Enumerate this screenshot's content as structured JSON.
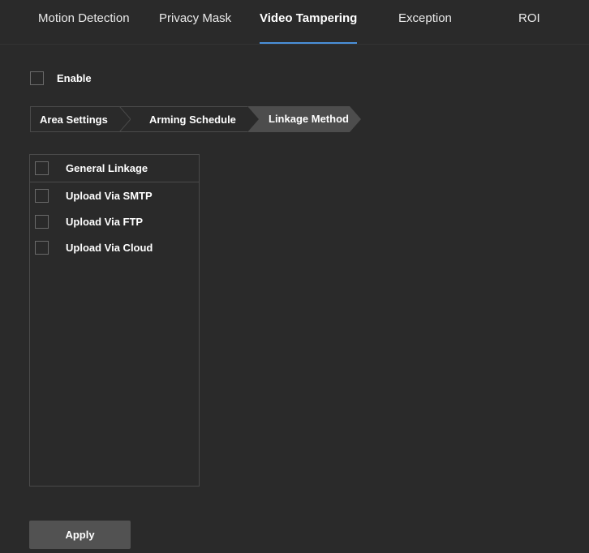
{
  "tabs": [
    {
      "label": "Motion Detection",
      "active": false
    },
    {
      "label": "Privacy Mask",
      "active": false
    },
    {
      "label": "Video Tampering",
      "active": true
    },
    {
      "label": "Exception",
      "active": false
    },
    {
      "label": "ROI",
      "active": false
    }
  ],
  "enable": {
    "label": "Enable",
    "checked": false
  },
  "steps": [
    {
      "label": "Area Settings",
      "active": false
    },
    {
      "label": "Arming Schedule",
      "active": false
    },
    {
      "label": "Linkage Method",
      "active": true
    }
  ],
  "linkage": {
    "header": {
      "label": "General Linkage",
      "checked": false
    },
    "items": [
      {
        "label": "Upload Via SMTP",
        "checked": false
      },
      {
        "label": "Upload Via FTP",
        "checked": false
      },
      {
        "label": "Upload Via Cloud",
        "checked": false
      }
    ]
  },
  "apply": {
    "label": "Apply"
  },
  "colors": {
    "background": "#2a2a2a",
    "active_tab_underline": "#4a90d9",
    "active_step": "#4d4d4d",
    "border": "#4a4a4a",
    "button": "#525252"
  }
}
